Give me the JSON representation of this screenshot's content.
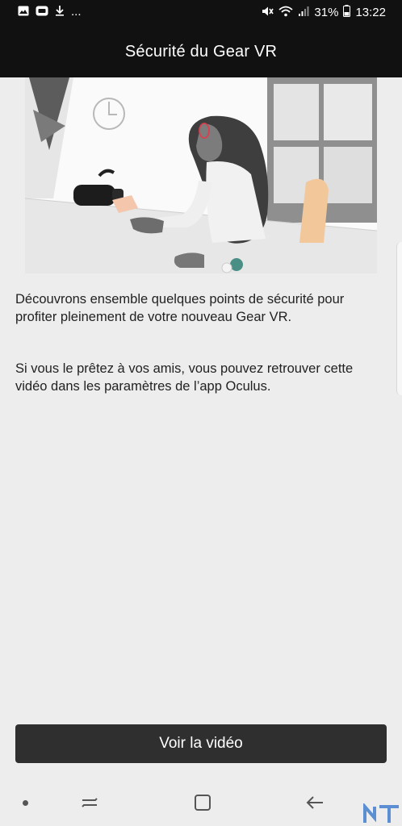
{
  "status_bar": {
    "battery_percent": "31%",
    "time": "13:22",
    "overflow": "...",
    "left_icons": [
      "image-icon",
      "message-icon",
      "download-icon"
    ],
    "right_icons": [
      "mute-icon",
      "wifi-icon",
      "signal-icon",
      "battery-icon"
    ]
  },
  "header": {
    "title": "Sécurité du Gear VR"
  },
  "content": {
    "paragraph_1": "Découvrons ensemble quelques points de sécurité pour profiter pleinement de votre nouveau Gear VR.",
    "paragraph_2": "Si vous le prêtez à vos amis, vous pouvez retrouver cette vidéo dans les paramètres de l’app Oculus."
  },
  "actions": {
    "watch_video_label": "Voir la vidéo"
  },
  "nav_bar": {
    "items": [
      "dot-icon",
      "recent-apps-icon",
      "home-icon",
      "back-icon"
    ]
  },
  "watermark": {
    "text": "NT"
  },
  "colors": {
    "status_bar_bg": "#111111",
    "background": "#ededed",
    "button_bg": "#2f2f2f",
    "chair_accent": "#f2c79a",
    "glasses_accent": "#d8404e"
  }
}
